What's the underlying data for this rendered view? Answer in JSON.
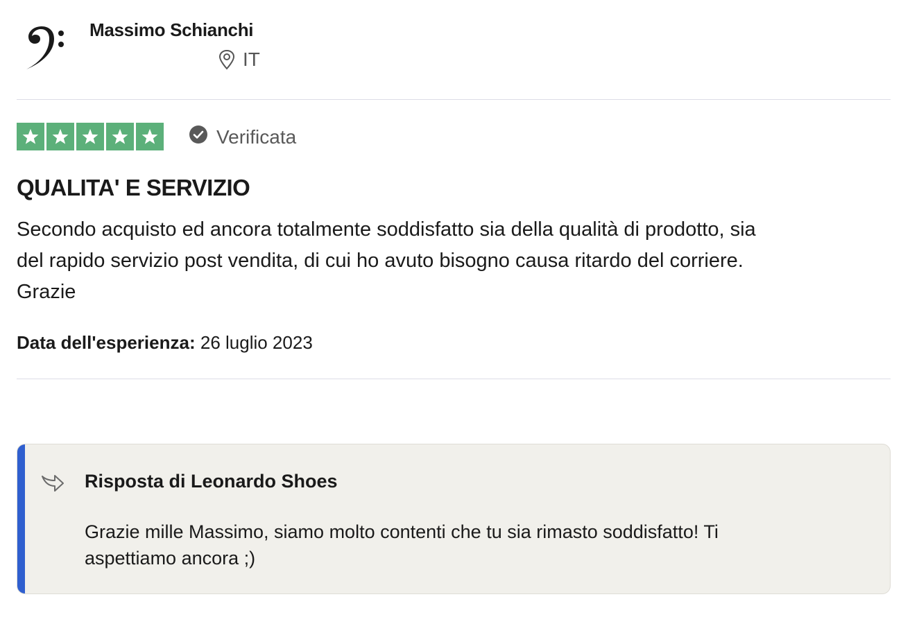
{
  "reviewer": {
    "name": "Massimo Schianchi",
    "country": "IT",
    "avatar_icon": "bass-clef-icon"
  },
  "rating": {
    "stars": 5,
    "star_color": "#5cb07a",
    "verified_label": "Verificata"
  },
  "review": {
    "title": "QUALITA' E SERVIZIO",
    "text_lines": [
      "Secondo acquisto ed ancora totalmente soddisfatto sia della qualità di prodotto, sia",
      "del rapido servizio post vendita, di cui ho avuto bisogno causa ritardo del corriere.",
      "Grazie"
    ],
    "experience_label": "Data dell'esperienza:",
    "experience_date": "26 luglio 2023"
  },
  "reply": {
    "title": "Risposta di Leonardo Shoes",
    "text_lines": [
      "Grazie mille Massimo, siamo molto contenti che tu sia rimasto soddisfatto! Ti",
      "aspettiamo ancora ;)"
    ],
    "accent_color": "#2f5fcf",
    "icon": "reply-arrow-icon"
  }
}
